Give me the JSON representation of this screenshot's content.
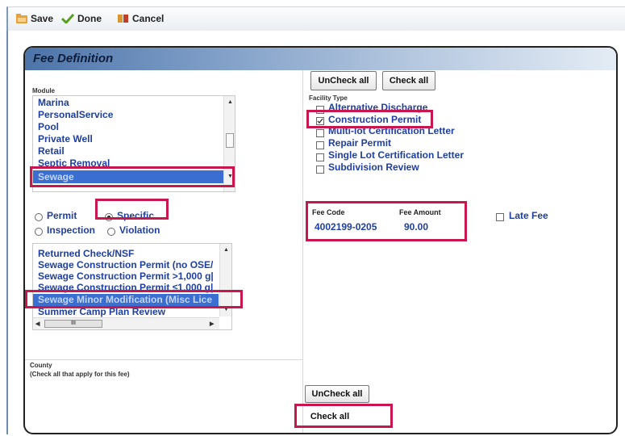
{
  "toolbar": {
    "save_label": "Save",
    "done_label": "Done",
    "cancel_label": "Cancel"
  },
  "panel": {
    "title": "Fee Definition"
  },
  "module": {
    "label": "Module",
    "items": [
      "Marina",
      "PersonalService",
      "Pool",
      "Private Well",
      "Retail",
      "Septic Removal",
      "Sewage"
    ],
    "selected": "Sewage"
  },
  "fee_scope": {
    "options": [
      "Permit",
      "Specific",
      "Inspection",
      "Violation"
    ],
    "selected": "Specific"
  },
  "fee_list": {
    "items": [
      "Returned Check/NSF",
      "Sewage Construction Permit (no OSE/",
      "Sewage Construction Permit >1,000 g|",
      "Sewage Construction Permit ≤1,000 g|",
      "Sewage Minor Modification (Misc Lice",
      "Summer Camp Plan Review"
    ],
    "selected_index": 4,
    "hscroll_thumb": "III"
  },
  "facility": {
    "uncheck_all": "UnCheck all",
    "check_all": "Check all",
    "label": "Facility Type",
    "types": [
      {
        "label": "Alternative Discharge",
        "checked": false
      },
      {
        "label": "Construction Permit",
        "checked": true
      },
      {
        "label": "Multi-lot Certification Letter",
        "checked": false
      },
      {
        "label": "Repair Permit",
        "checked": false
      },
      {
        "label": "Single Lot Certification Letter",
        "checked": false
      },
      {
        "label": "Subdivision Review",
        "checked": false
      }
    ]
  },
  "fee": {
    "code_label": "Fee Code",
    "code_value": "4002199-0205",
    "amount_label": "Fee Amount",
    "amount_value": "90.00",
    "late_fee_label": "Late Fee",
    "late_fee_checked": false
  },
  "county": {
    "label": "County",
    "hint": "(Check all that apply for this fee)",
    "uncheck_all": "UnCheck all",
    "check_all": "Check all"
  },
  "colors": {
    "highlight": "#c8174e",
    "link_text": "#1f3fa0",
    "selection": "#3a6fd1"
  }
}
